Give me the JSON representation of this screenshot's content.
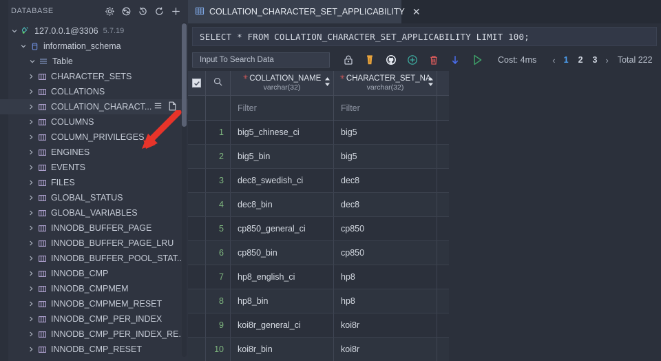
{
  "sidebar": {
    "title": "DATABASE",
    "header_icons": [
      {
        "name": "gear-icon",
        "label": "Settings"
      },
      {
        "name": "sync-icon",
        "label": "Sync"
      },
      {
        "name": "history-icon",
        "label": "History"
      },
      {
        "name": "refresh-icon",
        "label": "Refresh"
      },
      {
        "name": "plus-icon",
        "label": "New Connection"
      }
    ],
    "connection": {
      "label": "127.0.0.1@3306",
      "version": "5.7.19"
    },
    "schema": {
      "label": "information_schema"
    },
    "group": {
      "label": "Table"
    },
    "tables": [
      {
        "label": "CHARACTER_SETS",
        "selected": false
      },
      {
        "label": "COLLATIONS",
        "selected": false
      },
      {
        "label": "COLLATION_CHARACT...",
        "selected": true
      },
      {
        "label": "COLUMNS",
        "selected": false
      },
      {
        "label": "COLUMN_PRIVILEGES",
        "selected": false
      },
      {
        "label": "ENGINES",
        "selected": false
      },
      {
        "label": "EVENTS",
        "selected": false
      },
      {
        "label": "FILES",
        "selected": false
      },
      {
        "label": "GLOBAL_STATUS",
        "selected": false
      },
      {
        "label": "GLOBAL_VARIABLES",
        "selected": false
      },
      {
        "label": "INNODB_BUFFER_PAGE",
        "selected": false
      },
      {
        "label": "INNODB_BUFFER_PAGE_LRU",
        "selected": false
      },
      {
        "label": "INNODB_BUFFER_POOL_STAT...",
        "selected": false
      },
      {
        "label": "INNODB_CMP",
        "selected": false
      },
      {
        "label": "INNODB_CMPMEM",
        "selected": false
      },
      {
        "label": "INNODB_CMPMEM_RESET",
        "selected": false
      },
      {
        "label": "INNODB_CMP_PER_INDEX",
        "selected": false
      },
      {
        "label": "INNODB_CMP_PER_INDEX_RE...",
        "selected": false
      },
      {
        "label": "INNODB_CMP_RESET",
        "selected": false
      }
    ],
    "row_actions": [
      {
        "name": "list-lines-icon"
      },
      {
        "name": "file-icon"
      }
    ]
  },
  "tab": {
    "label": "COLLATION_CHARACTER_SET_APPLICABILITY",
    "close": "✕",
    "icon": "table-grid-icon"
  },
  "sql": {
    "statement": "SELECT * FROM COLLATION_CHARACTER_SET_APPLICABILITY LIMIT 100;"
  },
  "toolbar": {
    "search_placeholder": "Input To Search Data",
    "search_value": "",
    "icons": [
      {
        "name": "lock-icon",
        "color": "#c8cedb"
      },
      {
        "name": "coffee-cup-icon",
        "color": "#e8a33d"
      },
      {
        "name": "github-icon",
        "color": "#e4e8ef"
      },
      {
        "name": "plus-circle-icon",
        "color": "#3fb6a8"
      },
      {
        "name": "trash-icon",
        "color": "#e05c5c"
      },
      {
        "name": "download-arrow-icon",
        "color": "#4a6ef0"
      },
      {
        "name": "run-play-icon",
        "color": "#3fa46a"
      }
    ],
    "cost_label": "Cost: 4ms",
    "pages": [
      "1",
      "2",
      "3"
    ],
    "active_page": "1",
    "prev_arrow": "‹",
    "next_arrow": "›",
    "total_label": "Total 222"
  },
  "grid": {
    "columns": [
      {
        "name": "COLLATION_NAME",
        "type": "varchar(32)",
        "required": true
      },
      {
        "name": "CHARACTER_SET_NA",
        "type": "varchar(32)",
        "required": true
      }
    ],
    "filter_placeholder": "Filter",
    "rows": [
      {
        "num": "1",
        "collation_name": "big5_chinese_ci",
        "character_set_name": "big5"
      },
      {
        "num": "2",
        "collation_name": "big5_bin",
        "character_set_name": "big5"
      },
      {
        "num": "3",
        "collation_name": "dec8_swedish_ci",
        "character_set_name": "dec8"
      },
      {
        "num": "4",
        "collation_name": "dec8_bin",
        "character_set_name": "dec8"
      },
      {
        "num": "5",
        "collation_name": "cp850_general_ci",
        "character_set_name": "cp850"
      },
      {
        "num": "6",
        "collation_name": "cp850_bin",
        "character_set_name": "cp850"
      },
      {
        "num": "7",
        "collation_name": "hp8_english_ci",
        "character_set_name": "hp8"
      },
      {
        "num": "8",
        "collation_name": "hp8_bin",
        "character_set_name": "hp8"
      },
      {
        "num": "9",
        "collation_name": "koi8r_general_ci",
        "character_set_name": "koi8r"
      },
      {
        "num": "10",
        "collation_name": "koi8r_bin",
        "character_set_name": "koi8r"
      }
    ]
  },
  "colors": {
    "background": "#2b303b",
    "sidebar": "#2f3440",
    "accent_blue": "#4c9ef0",
    "row_number_green": "#7fb77f",
    "required_star_red": "#e05c5c",
    "cursor_arrow": "#e8342a"
  }
}
